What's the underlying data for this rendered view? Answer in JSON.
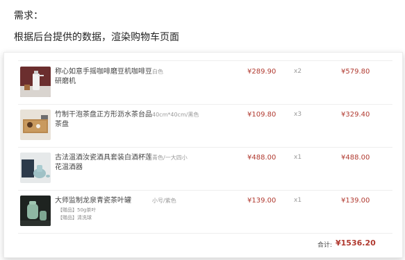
{
  "heading": "需求：",
  "subheading": "根据后台提供的数据，渲染购物车页面",
  "cart": {
    "items": [
      {
        "name": "称心如意手摇咖啡磨豆机咖啡豆研磨机",
        "spec": "白色",
        "price": "¥289.90",
        "qty": "x2",
        "subtotal": "¥579.80",
        "gifts": [],
        "image_icon": "coffee-grinder"
      },
      {
        "name": "竹制干泡茶盘正方形沥水茶台品茶盘",
        "spec": "40cm*40cm/黑色",
        "price": "¥109.80",
        "qty": "x3",
        "subtotal": "¥329.40",
        "gifts": [],
        "image_icon": "tea-tray"
      },
      {
        "name": "古法温酒汝瓷酒具套装白酒杯莲花温酒器",
        "spec": "青色/一大四小",
        "price": "¥488.00",
        "qty": "x1",
        "subtotal": "¥488.00",
        "gifts": [],
        "image_icon": "wine-set"
      },
      {
        "name": "大师监制龙泉青瓷茶叶罐",
        "spec": "小号/紫色",
        "price": "¥139.00",
        "qty": "x1",
        "subtotal": "¥139.00",
        "gifts": [
          "【赠品】50g茶叶",
          "【赠品】清洗球"
        ],
        "image_icon": "tea-jar"
      }
    ],
    "total_label": "合计:",
    "total": "¥1536.20"
  },
  "colors": {
    "price": "#b0392f",
    "border": "#eeeeee"
  }
}
